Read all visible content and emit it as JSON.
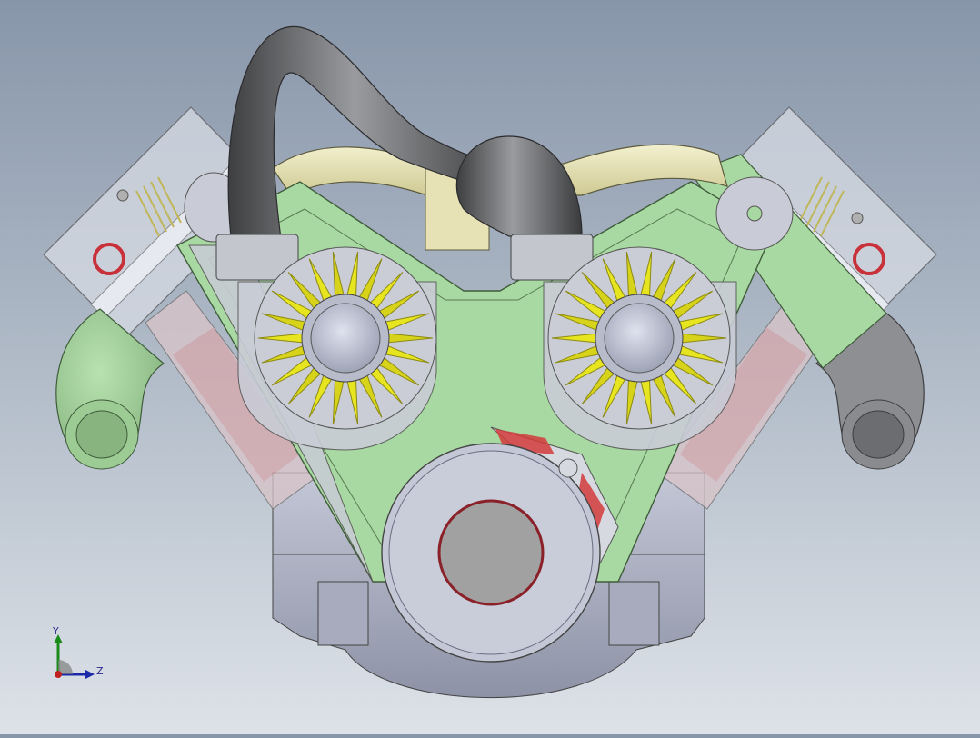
{
  "viewport": {
    "background_top": "#8896aa",
    "background_bottom": "#dde2e8"
  },
  "colors": {
    "block_green": "#a9d9a2",
    "pipe_dark": "#5f6062",
    "pipe_cream": "#e6e2b6",
    "gear_yellow": "#e7e420",
    "gear_dark": "#8c8a12",
    "metal": "#c9ccd6",
    "ring_red": "#c8303a",
    "glass": "#d7dbe3"
  },
  "model": {
    "parts": [
      "left-cylinder-head",
      "right-cylinder-head",
      "exhaust-pipe",
      "intake-pipe",
      "left-cam-gear",
      "right-cam-gear",
      "crank-pulley",
      "oil-pan"
    ]
  },
  "triad": {
    "y_label": "Y",
    "z_label": "Z"
  }
}
